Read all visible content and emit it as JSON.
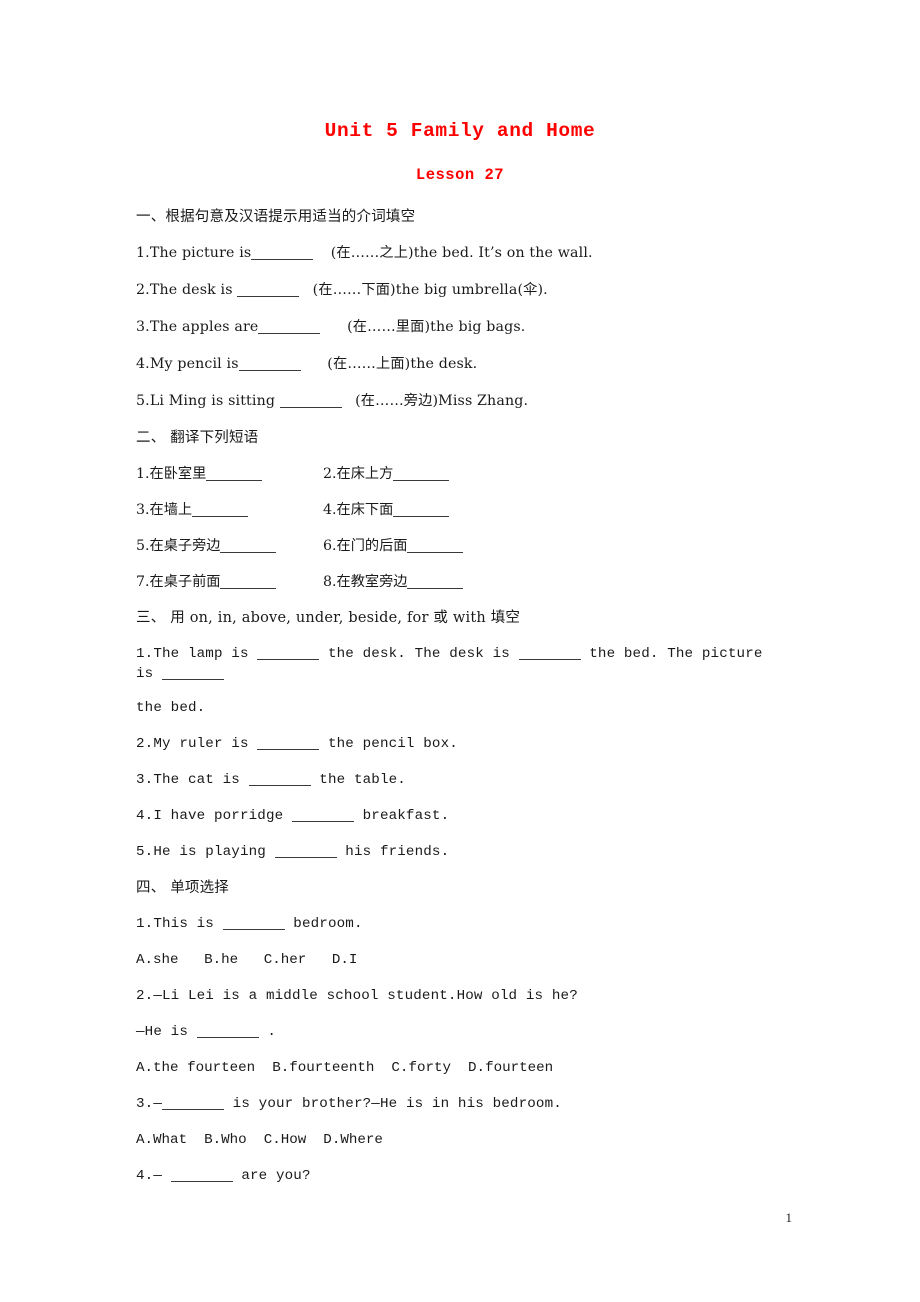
{
  "document": {
    "title": "Unit 5 Family and Home",
    "subtitle": "Lesson 27",
    "title_color": "#ff0000",
    "page_number": "1"
  },
  "sections": [
    {
      "heading": "一、根据句意及汉语提示用适当的介词填空",
      "questions": [
        {
          "pre": "1.The picture is",
          "post": "(在……之上)the bed. It’s on the wall."
        },
        {
          "pre": "2.The desk is ",
          "post": " (在……下面)the big umbrella(伞)."
        },
        {
          "pre": "3.The apples are",
          "post": "  (在……里面)the big bags."
        },
        {
          "pre": "4.My pencil is",
          "post": "  (在……上面)the desk."
        },
        {
          "pre": "5.Li Ming is sitting ",
          "post": " (在……旁边)Miss Zhang."
        }
      ]
    },
    {
      "heading": "二、 翻译下列短语",
      "pairs": [
        {
          "left": "1.在卧室里",
          "right": "2.在床上方"
        },
        {
          "left": "3.在墙上",
          "right": "4.在床下面"
        },
        {
          "left": "5.在桌子旁边",
          "right": "6.在门的后面"
        },
        {
          "left": "7.在桌子前面",
          "right": "8.在教室旁边"
        }
      ]
    },
    {
      "heading": "三、 用 on, in, above, under, beside, for 或 with 填空",
      "q1_a": "1.The lamp is ",
      "q1_b": " the desk. The desk is ",
      "q1_c": " the bed. The picture is ",
      "q1_cont": "the bed.",
      "questions": [
        {
          "pre": "2.My ruler is ",
          "post": " the pencil box."
        },
        {
          "pre": "3.The cat is ",
          "post": " the table."
        },
        {
          "pre": "4.I have porridge ",
          "post": " breakfast."
        },
        {
          "pre": "5.He is playing ",
          "post": " his friends."
        }
      ]
    },
    {
      "heading": "四、 单项选择",
      "items": [
        {
          "stem_pre": "1.This is ",
          "stem_post": " bedroom.",
          "options": "A.she   B.he   C.her   D.I"
        },
        {
          "stem_pre": "2.—Li Lei is a middle school student.How old is he?",
          "stem_post": "",
          "answer_pre": "—He is ",
          "answer_post": " .",
          "options": "A.the fourteen  B.fourteenth  C.forty  D.fourteen"
        },
        {
          "stem_pre": "3.—",
          "stem_post": " is your brother?—He is in his bedroom.",
          "options": "A.What  B.Who  C.How  D.Where"
        },
        {
          "stem_pre": "4.— ",
          "stem_post": " are you?",
          "options": ""
        }
      ]
    }
  ]
}
